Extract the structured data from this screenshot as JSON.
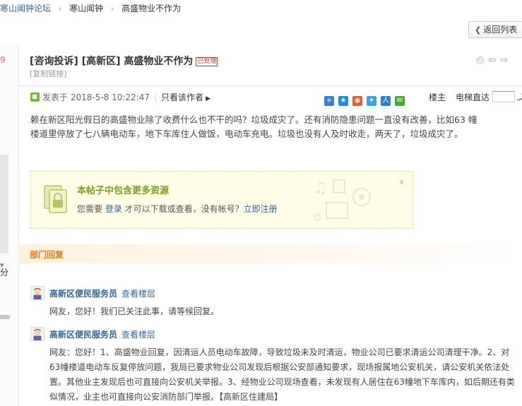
{
  "breadcrumb": {
    "items": [
      "寒山闻钟论坛",
      "寒山闻钟",
      "高盛物业不作为"
    ],
    "sep": "›"
  },
  "toolbar": {
    "back_label": "返回列表",
    "back_icon": "chevron-left-icon"
  },
  "left_strip": {
    "number": "9",
    "fen": "分"
  },
  "thread": {
    "title": "[咨询投诉] [高新区] 高盛物业不作为",
    "status_badge": "已处理",
    "copy_link": "[复制链接]"
  },
  "post": {
    "posted_at": "发表于 2018-5-8 10:22:47",
    "only_author": "只看该作者",
    "louzhu": "楼主",
    "elevator_label": "电梯直达",
    "body": "赖在新区阳光假日的高盛物业除了收费什么也不干的吗？垃圾成灾了。还有消防隐患问题一直没有改善，比如63 幢楼道里停放了七八辆电动车，地下车库住人做饭，电动车充电。垃圾也没有人及时收走，两天了，垃圾成灾了。"
  },
  "attachment_notice": {
    "title": "本帖子中包含更多资源",
    "text_before": "您需要 ",
    "login_link": "登录",
    "text_middle": " 才可以下载或查看，没有帐号？",
    "register_link": "立即注册",
    "close": "x",
    "accent_color": "#7b9e1e"
  },
  "department_reply": {
    "label": "部门回复",
    "replies": [
      {
        "name": "高新区便民服务员",
        "view_floor": "查看楼层",
        "text": "网友，您好！我们已关注此事，请等候回复。"
      },
      {
        "name": "高新区便民服务员",
        "view_floor": "查看楼层",
        "text": "网友：您好！1、高盛物业回复，因清运人员电动车故障，导致垃圾未及时清运，物业公司已要求清运公司清理干净。2、对63幢楼道电动车反复停放问题，我局已要求物业公司发现后根据公安部通知要求，现场报属地公安机关，请公安机关依法处置。其他业主发现后也可直接向公安机关举报。3、经物业公司现场查看，未发现有人居住在63幢地下车库内，如后期还有类似情况，业主也可直接向公安消防部门举报。【高新区住建局】"
      }
    ]
  },
  "colors": {
    "link": "#336699",
    "badge": "#e02e2e",
    "dept": "#e87b16"
  }
}
